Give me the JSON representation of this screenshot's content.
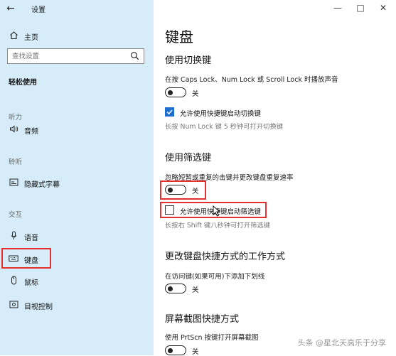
{
  "window": {
    "title": "设置",
    "controls": [
      "—",
      "□",
      "✕"
    ]
  },
  "sidebar": {
    "home": "主页",
    "search_placeholder": "查找设置",
    "category": "轻松使用",
    "sections": {
      "hearing": "听力",
      "vision": "聆听",
      "interaction": "交互"
    },
    "items": {
      "audio": "音频",
      "captions": "隐藏式字幕",
      "speech": "语音",
      "keyboard": "键盘",
      "mouse": "鼠标",
      "eye_control": "目视控制"
    }
  },
  "main": {
    "title": "键盘",
    "sticky_keys": {
      "heading": "使用切换键",
      "description": "在按 Caps Lock、Num Lock 或 Scroll Lock 时播放声音",
      "toggle_state": "关",
      "toggle_on": false,
      "checkbox_label": "允许使用快捷键启动切换键",
      "checkbox_checked": true,
      "hint": "长按 Num Lock 键 5 秒钟可打开切换键"
    },
    "filter_keys": {
      "heading": "使用筛选键",
      "description": "忽略短暂或重复的击键并更改键盘重复速率",
      "toggle_state": "关",
      "toggle_on": false,
      "checkbox_label": "允许使用快捷键启动筛选键",
      "checkbox_checked": false,
      "hint": "长按右 Shift 键八秒钟可打开筛选键"
    },
    "shortcut_underline": {
      "heading": "更改键盘快捷方式的工作方式",
      "description": "在访问键(如果可用)下添加下划线",
      "toggle_state": "关",
      "toggle_on": false
    },
    "print_screen": {
      "heading": "屏幕截图快捷方式",
      "description": "使用 PrtScn 按键打开屏幕截图",
      "toggle_state": "关",
      "toggle_on": false
    }
  },
  "watermark": "头条 @星北天高乐于分享",
  "colors": {
    "sidebar_bg": "#d6edf9",
    "accent": "#1e6fcf",
    "highlight": "#e53030"
  }
}
